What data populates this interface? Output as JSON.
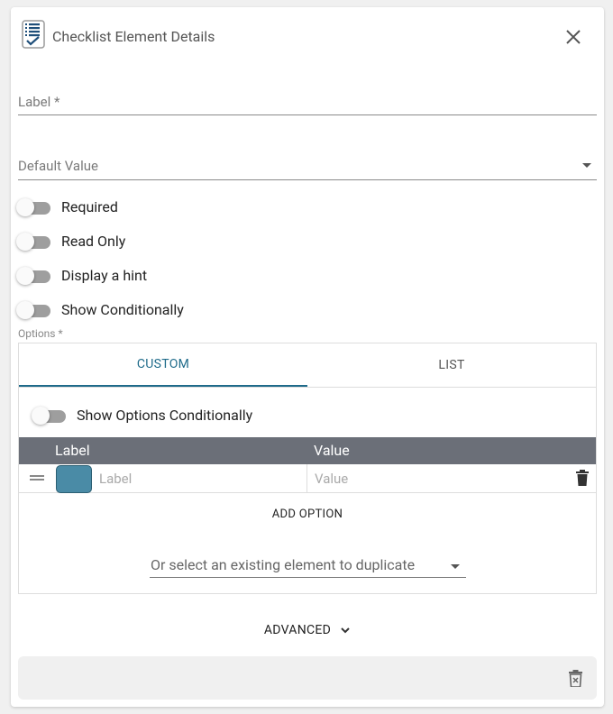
{
  "dialog": {
    "title": "Checklist Element Details",
    "icon": "checklist-icon",
    "close_icon": "close-icon"
  },
  "fields": {
    "label": {
      "placeholder": "Label *",
      "value": ""
    },
    "default_value": {
      "placeholder": "Default Value",
      "value": ""
    }
  },
  "toggles": [
    {
      "label": "Required",
      "on": false
    },
    {
      "label": "Read Only",
      "on": false
    },
    {
      "label": "Display a hint",
      "on": false
    },
    {
      "label": "Show Conditionally",
      "on": false
    }
  ],
  "options": {
    "section_label": "Options *",
    "tabs": [
      {
        "label": "CUSTOM",
        "active": true
      },
      {
        "label": "LIST",
        "active": false
      }
    ],
    "show_options_conditionally": {
      "label": "Show Options Conditionally",
      "on": false
    },
    "table": {
      "headers": [
        "Label",
        "Value"
      ],
      "rows": [
        {
          "color": "#4a8ba6",
          "label_placeholder": "Label",
          "value_placeholder": "Value"
        }
      ]
    },
    "add_option_label": "ADD OPTION",
    "duplicate_placeholder": "Or select an existing element to duplicate"
  },
  "advanced_label": "ADVANCED",
  "colors": {
    "accent": "#1f6b8a",
    "table_header": "#6b6f78",
    "toggle_off": "#9e9e9e"
  }
}
